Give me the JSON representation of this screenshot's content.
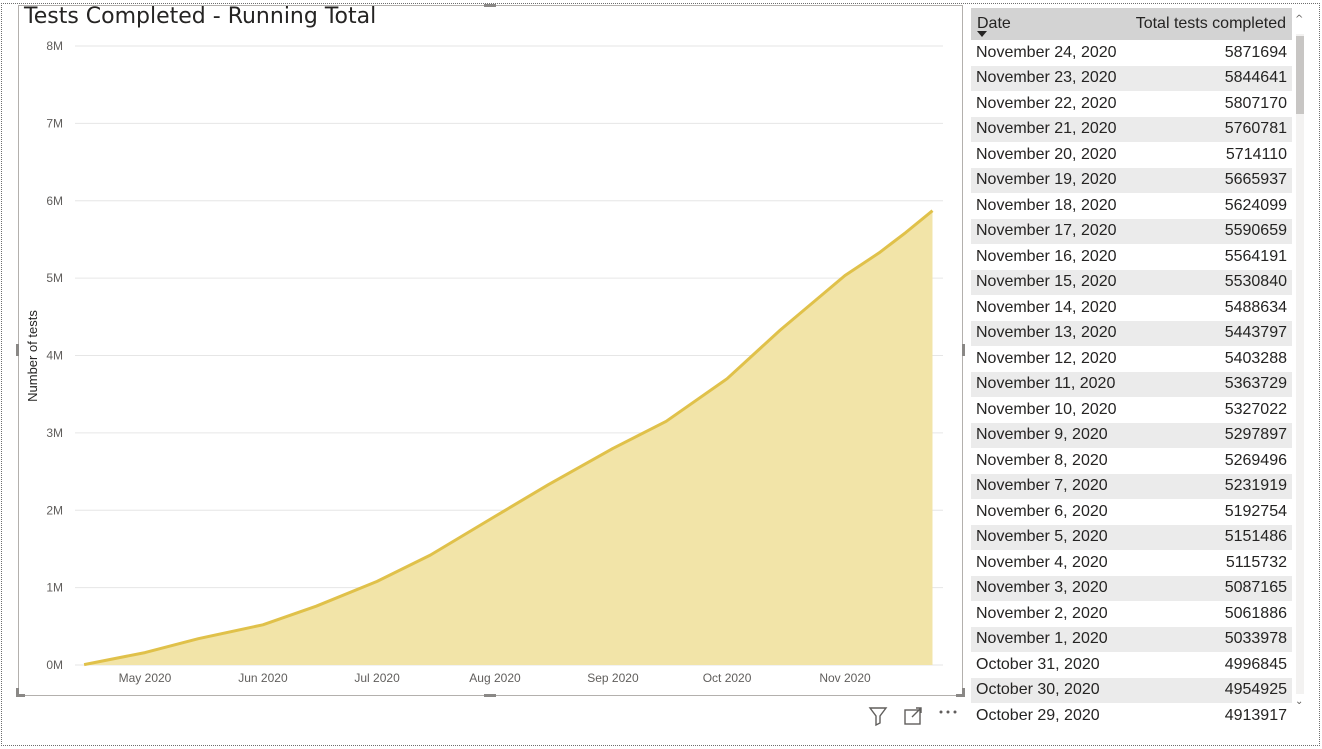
{
  "chart_data": {
    "type": "area",
    "title": "Tests Completed - Running Total",
    "xlabel": "",
    "ylabel": "Number of tests",
    "x_ticks": [
      "May 2020",
      "Jun 2020",
      "Jul 2020",
      "Aug 2020",
      "Sep 2020",
      "Oct 2020",
      "Nov 2020"
    ],
    "y_ticks": [
      "0M",
      "1M",
      "2M",
      "3M",
      "4M",
      "5M",
      "6M",
      "7M",
      "8M"
    ],
    "ylim": [
      0,
      8000000
    ],
    "xlim": [
      "2020-04-15",
      "2020-11-24"
    ],
    "grid": true,
    "line_color": "#e0c14a",
    "fill_color": "#f2e4a8",
    "series": [
      {
        "points": [
          {
            "x": "2020-04-15",
            "y": 5000
          },
          {
            "x": "2020-05-01",
            "y": 160000
          },
          {
            "x": "2020-05-15",
            "y": 340000
          },
          {
            "x": "2020-06-01",
            "y": 520000
          },
          {
            "x": "2020-06-15",
            "y": 760000
          },
          {
            "x": "2020-07-01",
            "y": 1080000
          },
          {
            "x": "2020-07-15",
            "y": 1420000
          },
          {
            "x": "2020-08-01",
            "y": 1920000
          },
          {
            "x": "2020-08-15",
            "y": 2330000
          },
          {
            "x": "2020-09-01",
            "y": 2800000
          },
          {
            "x": "2020-09-15",
            "y": 3150000
          },
          {
            "x": "2020-10-01",
            "y": 3700000
          },
          {
            "x": "2020-10-15",
            "y": 4330000
          },
          {
            "x": "2020-11-01",
            "y": 5033978
          },
          {
            "x": "2020-11-10",
            "y": 5327022
          },
          {
            "x": "2020-11-17",
            "y": 5590659
          },
          {
            "x": "2020-11-24",
            "y": 5871694
          }
        ]
      }
    ]
  },
  "table": {
    "headers": [
      "Date",
      "Total tests completed"
    ],
    "rows": [
      [
        "November 24, 2020",
        "5871694"
      ],
      [
        "November 23, 2020",
        "5844641"
      ],
      [
        "November 22, 2020",
        "5807170"
      ],
      [
        "November 21, 2020",
        "5760781"
      ],
      [
        "November 20, 2020",
        "5714110"
      ],
      [
        "November 19, 2020",
        "5665937"
      ],
      [
        "November 18, 2020",
        "5624099"
      ],
      [
        "November 17, 2020",
        "5590659"
      ],
      [
        "November 16, 2020",
        "5564191"
      ],
      [
        "November 15, 2020",
        "5530840"
      ],
      [
        "November 14, 2020",
        "5488634"
      ],
      [
        "November 13, 2020",
        "5443797"
      ],
      [
        "November 12, 2020",
        "5403288"
      ],
      [
        "November 11, 2020",
        "5363729"
      ],
      [
        "November 10, 2020",
        "5327022"
      ],
      [
        "November 9, 2020",
        "5297897"
      ],
      [
        "November 8, 2020",
        "5269496"
      ],
      [
        "November 7, 2020",
        "5231919"
      ],
      [
        "November 6, 2020",
        "5192754"
      ],
      [
        "November 5, 2020",
        "5151486"
      ],
      [
        "November 4, 2020",
        "5115732"
      ],
      [
        "November 3, 2020",
        "5087165"
      ],
      [
        "November 2, 2020",
        "5061886"
      ],
      [
        "November 1, 2020",
        "5033978"
      ],
      [
        "October 31, 2020",
        "4996845"
      ],
      [
        "October 30, 2020",
        "4954925"
      ],
      [
        "October 29, 2020",
        "4913917"
      ]
    ]
  },
  "icons": {
    "filter": "filter-icon",
    "focus": "focus-mode-icon",
    "more": "more-options-icon"
  }
}
